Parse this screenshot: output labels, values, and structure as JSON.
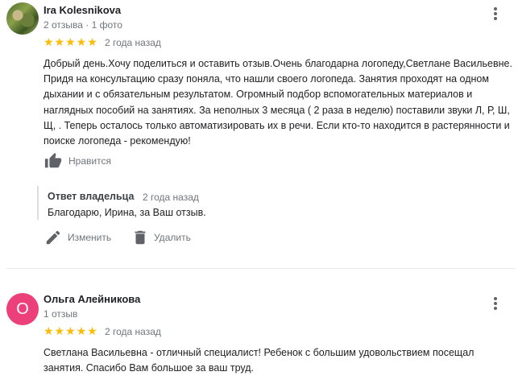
{
  "reviews": [
    {
      "author": "Ira Kolesnikova",
      "meta": "2 отзыва · 1 фото",
      "stars": "★★★★★",
      "date": "2 года назад",
      "text": "Добрый день.Хочу поделиться и оставить отзыв.Очень благодарна логопеду,Светлане Васильевне. Придя на консультацию сразу поняла, что нашли своего логопеда. Занятия проходят на одном дыхании и с обязательным результатом. Огромный подбор вспомогательных материалов и наглядных пособий на занятиях. За неполных 3 месяца ( 2 раза в неделю) поставили звуки Л, Р, Ш, Щ, . Теперь осталось только автоматизировать их в речи. Если кто-то находится в растерянности и поиске логопеда - рекомендую!",
      "like_label": "Нравится",
      "owner_reply": {
        "title": "Ответ владельца",
        "date": "2 года назад",
        "text": "Благодарю, Ирина, за Ваш отзыв.",
        "edit_label": "Изменить",
        "delete_label": "Удалить"
      }
    },
    {
      "author": "Ольга Алейникова",
      "avatar_letter": "О",
      "avatar_color": "#ec407a",
      "meta": "1 отзыв",
      "stars": "★★★★★",
      "date": "2 года назад",
      "text": "Светлана Васильевна - отличный специалист! Ребенок с большим удовольствием посещал занятия. Спасибо Вам большое за ваш труд."
    }
  ],
  "colors": {
    "star": "#fbbc04",
    "secondary_text": "#70757a",
    "icon": "#5f6368"
  },
  "icons": [
    "avatar-photo",
    "more-vert-icon",
    "thumb-up-icon",
    "edit-pencil-icon",
    "trash-icon"
  ]
}
